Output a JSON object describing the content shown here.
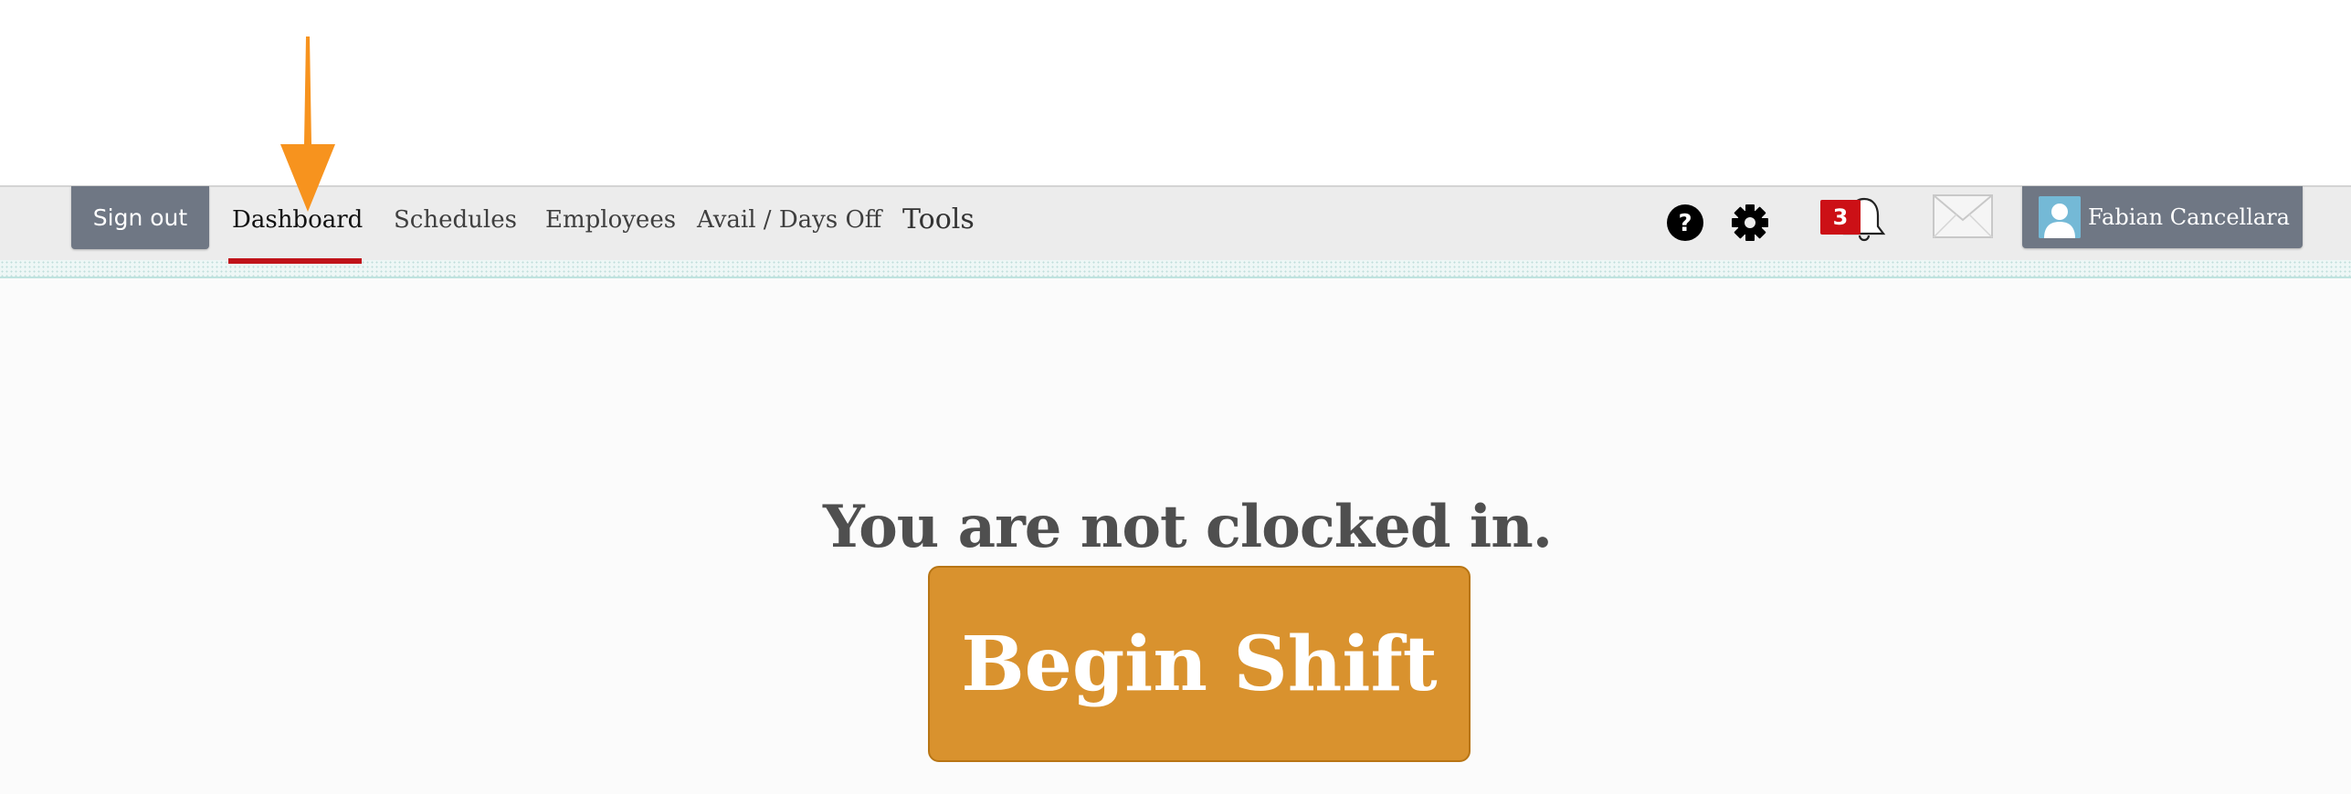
{
  "nav": {
    "signout_label": "Sign out",
    "items": [
      {
        "label": "Dashboard",
        "active": true
      },
      {
        "label": "Schedules",
        "active": false
      },
      {
        "label": "Employees",
        "active": false
      },
      {
        "label": "Avail / Days Off",
        "active": false
      },
      {
        "label": "Tools",
        "active": false
      }
    ],
    "icons": {
      "help": "question-circle-icon",
      "settings": "gear-icon",
      "notifications": "bell-icon",
      "messages": "envelope-icon",
      "avatar": "user-avatar-icon"
    },
    "notification_count": "3",
    "user_name": "Fabian Cancellara"
  },
  "main": {
    "status_text": "You are not clocked in.",
    "begin_shift_label": "Begin Shift"
  },
  "annotation": {
    "arrow_color": "#f7931e",
    "arrow_icon": "down-arrow-icon"
  },
  "colors": {
    "accent_underline": "#c0131a",
    "begin_shift_bg": "#d9922e",
    "nav_button_bg": "#6f7784",
    "badge_bg": "#cc1016"
  }
}
